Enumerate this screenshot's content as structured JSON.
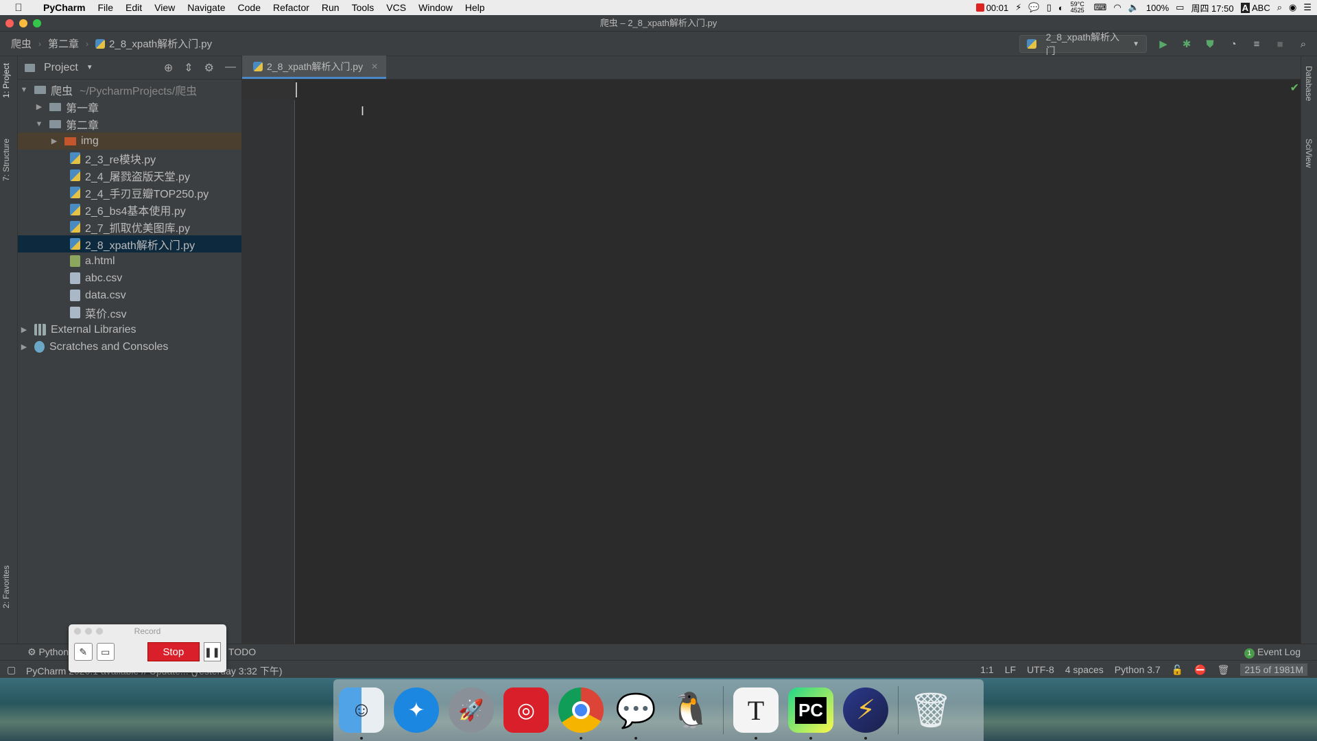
{
  "menubar": {
    "app": "PyCharm",
    "items": [
      "File",
      "Edit",
      "View",
      "Navigate",
      "Code",
      "Refactor",
      "Run",
      "Tools",
      "VCS",
      "Window",
      "Help"
    ],
    "record_timer": "00:01",
    "weather": "59°C 4525",
    "battery": "100%",
    "clock": "周四 17:50",
    "input_method": "ABC"
  },
  "window": {
    "title": "爬虫 – 2_8_xpath解析入门.py"
  },
  "breadcrumb": [
    "爬虫",
    "第二章",
    "2_8_xpath解析入门.py"
  ],
  "run_config": {
    "name": "2_8_xpath解析入门"
  },
  "left_tabs": {
    "project": "1: Project",
    "structure": "7: Structure",
    "favorites": "2: Favorites"
  },
  "right_tabs": {
    "database": "Database",
    "sciview": "SciView"
  },
  "project_panel": {
    "title": "Project",
    "root": {
      "name": "爬虫",
      "path": "~/PycharmProjects/爬虫"
    },
    "ch1": "第一章",
    "ch2": "第二章",
    "img": "img",
    "files": [
      "2_3_re模块.py",
      "2_4_屠戮盗版天堂.py",
      "2_4_手刃豆瓣TOP250.py",
      "2_6_bs4基本使用.py",
      "2_7_抓取优美图库.py",
      "2_8_xpath解析入门.py"
    ],
    "other_files": [
      "a.html",
      "abc.csv",
      "data.csv",
      "菜价.csv"
    ],
    "external": "External Libraries",
    "scratches": "Scratches and Consoles"
  },
  "editor": {
    "tab": "2_8_xpath解析入门.py"
  },
  "bottom_tools": {
    "python": "Python",
    "todo": "TODO",
    "event_log": "Event Log",
    "event_count": "1"
  },
  "status": {
    "message": "PyCharm 2020.1 available // Update... (yesterday 3:32 下午)",
    "position": "1:1",
    "line_sep": "LF",
    "encoding": "UTF-8",
    "indent": "4 spaces",
    "interpreter": "Python 3.7",
    "memory": "215 of 1981M"
  },
  "recorder": {
    "title": "Record",
    "stop": "Stop"
  }
}
